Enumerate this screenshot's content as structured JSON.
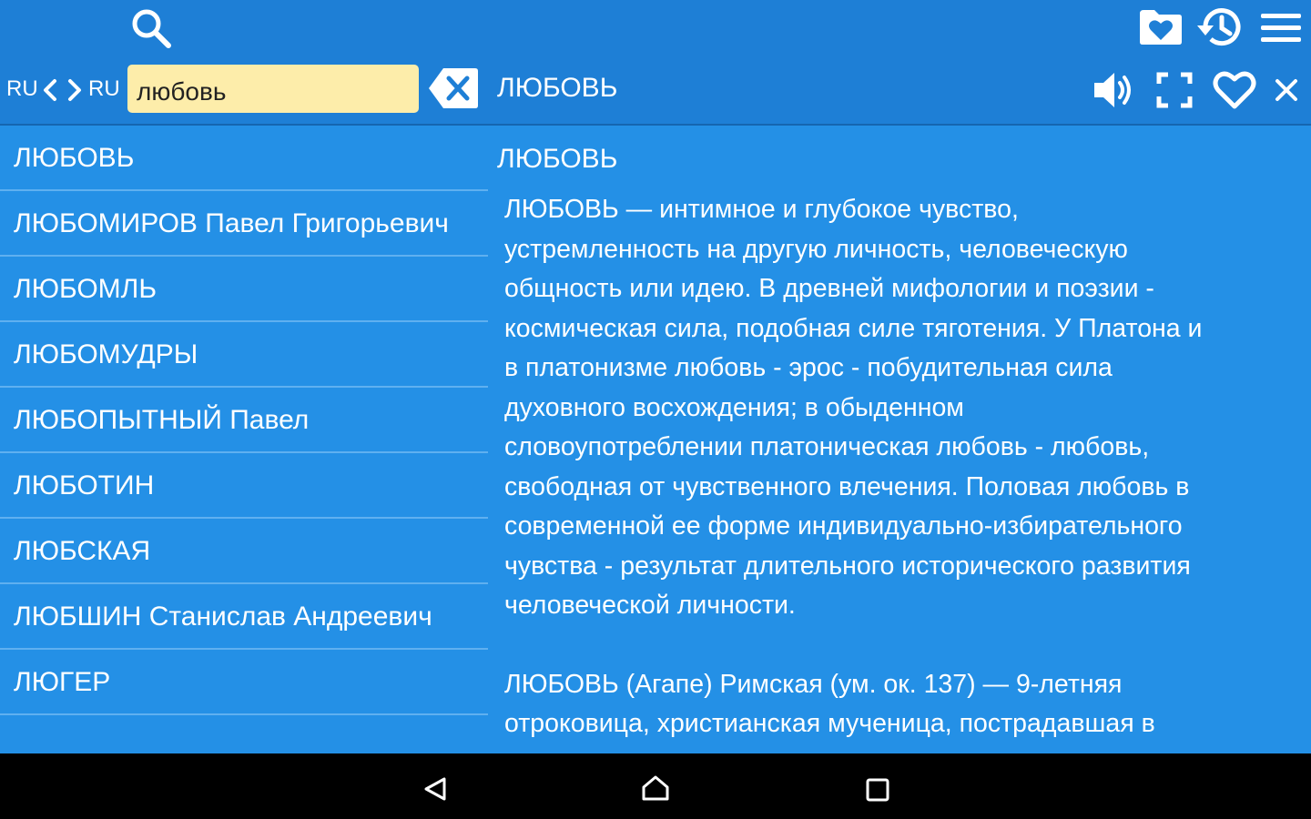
{
  "app": {
    "accent_color": "#1e7fd6",
    "content_bg": "#2490e6",
    "field_bg": "#fdedaa"
  },
  "toolbar": {
    "icons": [
      "search-icon",
      "favorites-folder-icon",
      "history-icon",
      "menu-icon"
    ]
  },
  "search": {
    "source_lang": "RU",
    "target_lang": "RU",
    "query": "любовь",
    "clear_icon": "clear-input-icon"
  },
  "entry_toolbar": {
    "headword": "ЛЮБОВЬ",
    "icons": [
      "speaker-icon",
      "fullscreen-icon",
      "heart-icon",
      "close-icon"
    ]
  },
  "word_list": {
    "items": [
      "ЛЮБОВЬ",
      "ЛЮБОМИРОВ Павел Григорьевич",
      "ЛЮБОМЛЬ",
      "ЛЮБОМУДРЫ",
      "ЛЮБОПЫТНЫЙ Павел",
      "ЛЮБОТИН",
      "ЛЮБСКАЯ",
      "ЛЮБШИН Станислав Андреевич",
      "ЛЮГЕР"
    ]
  },
  "article": {
    "title": "ЛЮБОВЬ",
    "paragraphs": [
      "ЛЮБОВЬ — интимное и глубокое чувство,\nустремленность на другую личность, человеческую\nобщность или идею. В древней мифологии и поэзии -\nкосмическая сила, подобная силе тяготения. У Платона и\nв платонизме любовь - эрос - побудительная сила\nдуховного восхождения; в обыденном\nсловоупотреблении платоническая любовь - любовь,\nсвободная от чувственного влечения. Половая любовь в\nсовременной ее форме индивидуально-избирательного\nчувства - результат длительного исторического развития\nчеловеческой личности.",
      "ЛЮБОВЬ (Агапе) Римская (ум. ок. 137) — 9-летняя\nотроковица, христианская мученица, пострадавшая в"
    ]
  },
  "system_nav": {
    "icons": [
      "back-icon",
      "home-icon",
      "recents-icon"
    ]
  }
}
